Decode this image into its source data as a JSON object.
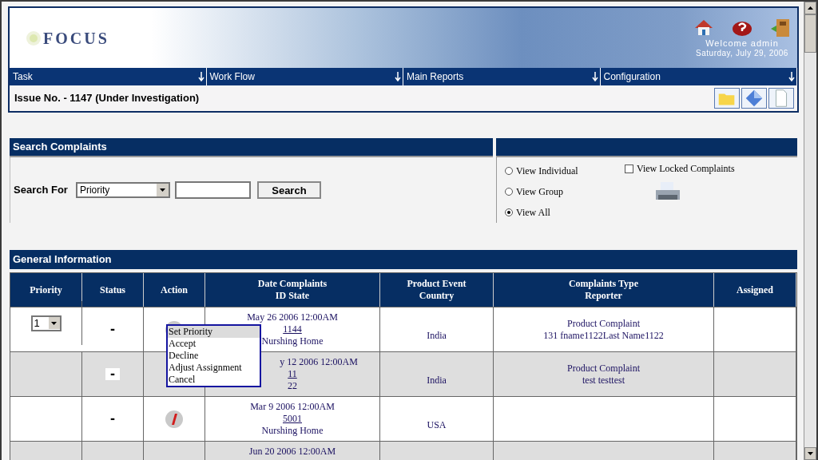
{
  "header": {
    "logo": "FOCUS",
    "welcome": "Welcome admin",
    "date": "Saturday, July 29, 2006"
  },
  "nav": [
    "Task",
    "Work Flow",
    "Main Reports",
    "Configuration"
  ],
  "issue": {
    "title": "Issue No. - 1147 (Under Investigation)"
  },
  "search": {
    "title": "Search Complaints",
    "label": "Search For",
    "field": "Priority",
    "button": "Search",
    "views": [
      {
        "label": "View Individual",
        "selected": false
      },
      {
        "label": "View Group",
        "selected": false
      },
      {
        "label": "View All",
        "selected": true
      }
    ],
    "locked": {
      "label": "View Locked Complaints",
      "checked": false
    }
  },
  "general": {
    "title": "General Information",
    "columns": [
      [
        "Priority"
      ],
      [
        "Status"
      ],
      [
        "Action"
      ],
      [
        "Date Complaints",
        "ID State"
      ],
      [
        "Product Event",
        "Country"
      ],
      [
        "Complaints Type",
        "Reporter"
      ],
      [
        "Assigned"
      ]
    ],
    "rows": [
      {
        "priority": "1",
        "status": "-",
        "info": true,
        "date": "May 26 2006 12:00AM",
        "id": "1144",
        "state": "Nurshing Home",
        "country": "India",
        "type": "Product Complaint",
        "reporter": "131 fname1122Last Name1122",
        "under_menu": false
      },
      {
        "status": "-",
        "info": false,
        "date": "y 12 2006 12:00AM",
        "id": "11",
        "state": "22",
        "country": "India",
        "type": "Product Complaint",
        "reporter": "test testtest",
        "under_menu": true
      },
      {
        "status": "-",
        "info": true,
        "date": "Mar 9 2006 12:00AM",
        "id": "5001",
        "state": "Nurshing Home",
        "country": "USA",
        "under_menu": false
      },
      {
        "date": "Jun 20 2006 12:00AM",
        "info": false,
        "under_menu": false
      }
    ],
    "menu": [
      {
        "label": "Set Priority",
        "selected": true
      },
      {
        "label": "Accept",
        "selected": false
      },
      {
        "label": "Decline",
        "selected": false
      },
      {
        "label": "Adjust Assignment",
        "selected": false
      },
      {
        "label": "Cancel",
        "selected": false
      }
    ]
  }
}
